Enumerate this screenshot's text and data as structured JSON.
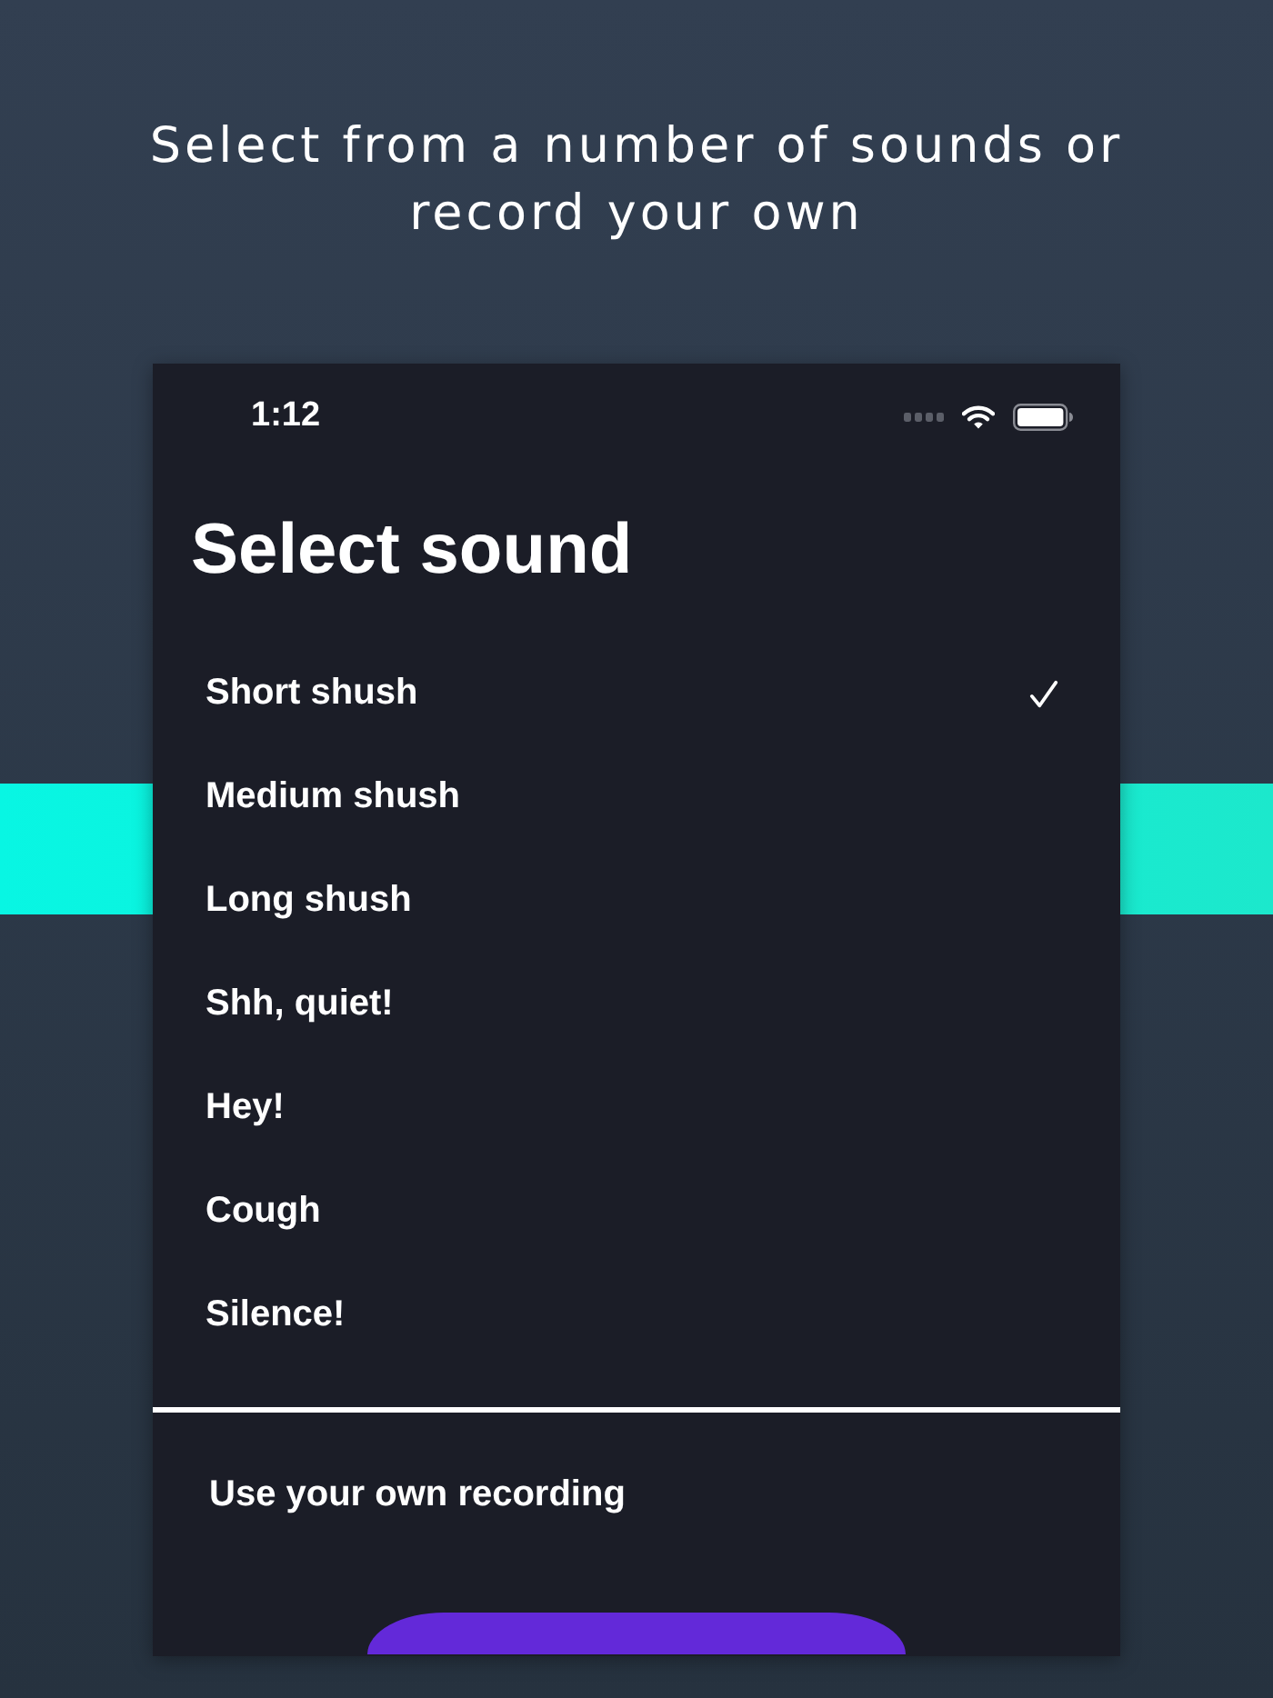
{
  "headline": "Select from a number of sounds or record your own",
  "status_bar": {
    "time": "1:12"
  },
  "title": "Select sound",
  "sounds": [
    {
      "label": "Short shush",
      "selected": true
    },
    {
      "label": "Medium shush",
      "selected": false
    },
    {
      "label": "Long shush",
      "selected": false
    },
    {
      "label": "Shh, quiet!",
      "selected": false
    },
    {
      "label": "Hey!",
      "selected": false
    },
    {
      "label": "Cough",
      "selected": false
    },
    {
      "label": "Silence!",
      "selected": false
    }
  ],
  "own_recording": {
    "label": "Use your own recording"
  }
}
